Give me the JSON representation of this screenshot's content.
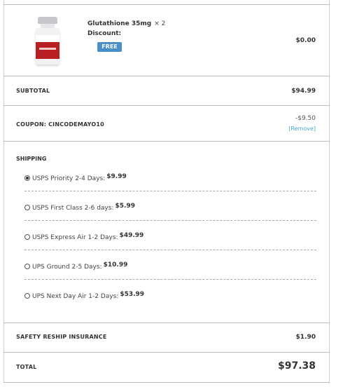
{
  "product": {
    "name": "Glutathione 35mg",
    "qty": "× 2",
    "discount_label": "Discount:",
    "badge": "FREE",
    "price": "$0.00",
    "image_icon": "product-vial-image"
  },
  "subtotal": {
    "label": "SUBTOTAL",
    "value": "$94.99"
  },
  "coupon": {
    "label": "COUPON: CINCODEMAYO10",
    "value": "-$9.50",
    "remove": "[Remove]"
  },
  "shipping": {
    "title": "SHIPPING",
    "selected": 0,
    "options": [
      {
        "label": "USPS Priority 2-4 Days:",
        "price": "$9.99"
      },
      {
        "label": "USPS First Class 2-6 days:",
        "price": "$5.99"
      },
      {
        "label": "USPS Express Air 1-2 Days:",
        "price": "$49.99"
      },
      {
        "label": "UPS Ground 2-5 Days:",
        "price": "$10.99"
      },
      {
        "label": "UPS Next Day Air 1-2 Days:",
        "price": "$53.99"
      }
    ]
  },
  "insurance": {
    "label": "SAFETY RESHIP INSURANCE",
    "value": "$1.90"
  },
  "total": {
    "label": "TOTAL",
    "value": "$97.38"
  },
  "colors": {
    "badge": "#4a90c8",
    "link": "#4aa8c9",
    "vial_label": "#b81e24"
  }
}
